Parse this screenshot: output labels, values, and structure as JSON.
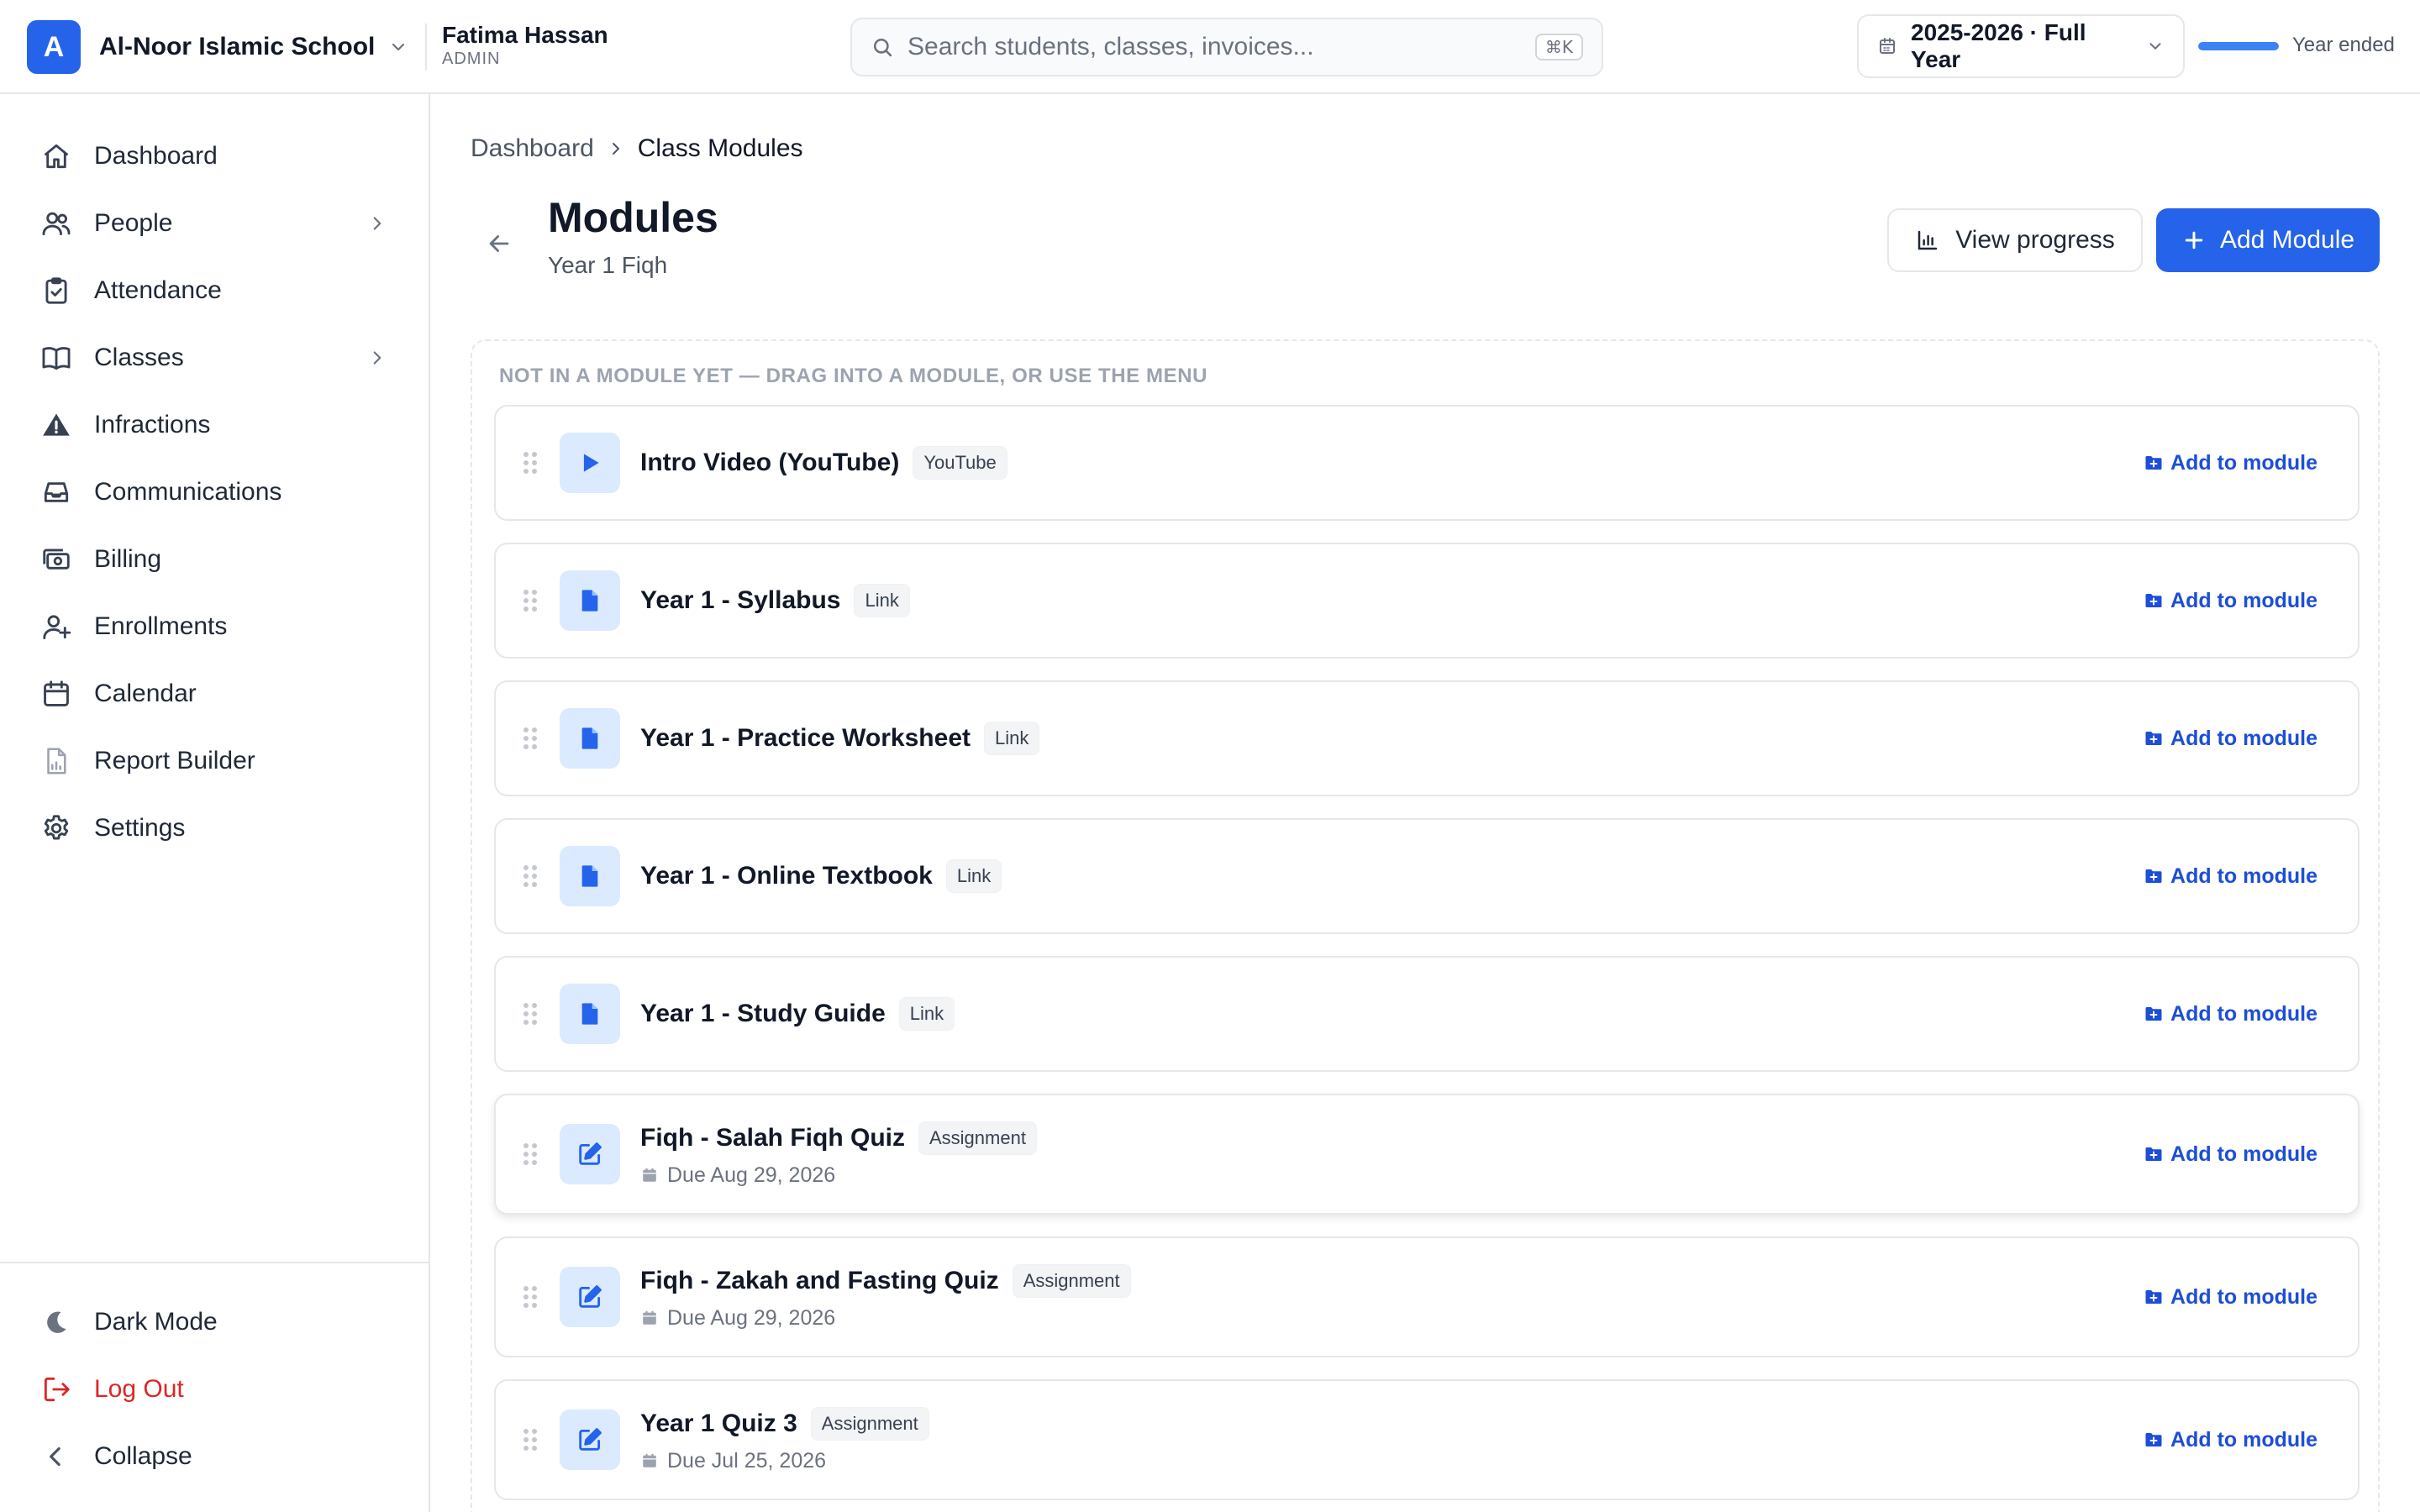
{
  "topbar": {
    "school_initial": "A",
    "school_name": "Al-Noor Islamic School",
    "user_name": "Fatima Hassan",
    "user_role": "ADMIN",
    "search_placeholder": "Search students, classes, invoices...",
    "search_shortcut": "⌘K",
    "year_label": "2025-2026 · Full Year",
    "year_progress": 1.0,
    "year_status": "Year ended"
  },
  "sidebar": {
    "items": [
      {
        "label": "Dashboard",
        "icon": "home-icon"
      },
      {
        "label": "People",
        "icon": "users-icon",
        "has_children": true
      },
      {
        "label": "Attendance",
        "icon": "clipboard-check-icon"
      },
      {
        "label": "Classes",
        "icon": "book-icon",
        "has_children": true
      },
      {
        "label": "Infractions",
        "icon": "warning-icon"
      },
      {
        "label": "Communications",
        "icon": "inbox-icon"
      },
      {
        "label": "Billing",
        "icon": "cash-icon"
      },
      {
        "label": "Enrollments",
        "icon": "user-plus-icon"
      },
      {
        "label": "Calendar",
        "icon": "calendar-icon"
      },
      {
        "label": "Report Builder",
        "icon": "report-icon"
      },
      {
        "label": "Settings",
        "icon": "gear-icon"
      }
    ],
    "bottom": {
      "dark_mode": "Dark Mode",
      "logout": "Log Out",
      "collapse": "Collapse"
    }
  },
  "main": {
    "breadcrumb": [
      "Dashboard",
      "Class Modules"
    ],
    "title": "Modules",
    "subtitle": "Year 1 Fiqh",
    "view_progress_label": "View progress",
    "add_module_label": "Add Module",
    "unassigned_hint": "NOT IN A MODULE YET — DRAG INTO A MODULE, OR USE THE MENU",
    "add_to_module_label": "Add to module",
    "items": [
      {
        "title": "Intro Video (YouTube)",
        "tag": "YouTube",
        "icon": "play-icon"
      },
      {
        "title": "Year 1 - Syllabus",
        "tag": "Link",
        "icon": "document-icon"
      },
      {
        "title": "Year 1 - Practice Worksheet",
        "tag": "Link",
        "icon": "document-icon"
      },
      {
        "title": "Year 1 - Online Textbook",
        "tag": "Link",
        "icon": "document-icon"
      },
      {
        "title": "Year 1 - Study Guide",
        "tag": "Link",
        "icon": "document-icon"
      },
      {
        "title": "Fiqh - Salah Fiqh Quiz",
        "tag": "Assignment",
        "icon": "edit-icon",
        "due": "Due Aug 29, 2026"
      },
      {
        "title": "Fiqh - Zakah and Fasting Quiz",
        "tag": "Assignment",
        "icon": "edit-icon",
        "due": "Due Aug 29, 2026"
      },
      {
        "title": "Year 1 Quiz 3",
        "tag": "Assignment",
        "icon": "edit-icon",
        "due": "Due Jul 25, 2026"
      }
    ]
  },
  "colors": {
    "accent": "#2563eb",
    "accent_light": "#dbeafe",
    "danger": "#dc2626",
    "border": "#e5e7eb"
  }
}
